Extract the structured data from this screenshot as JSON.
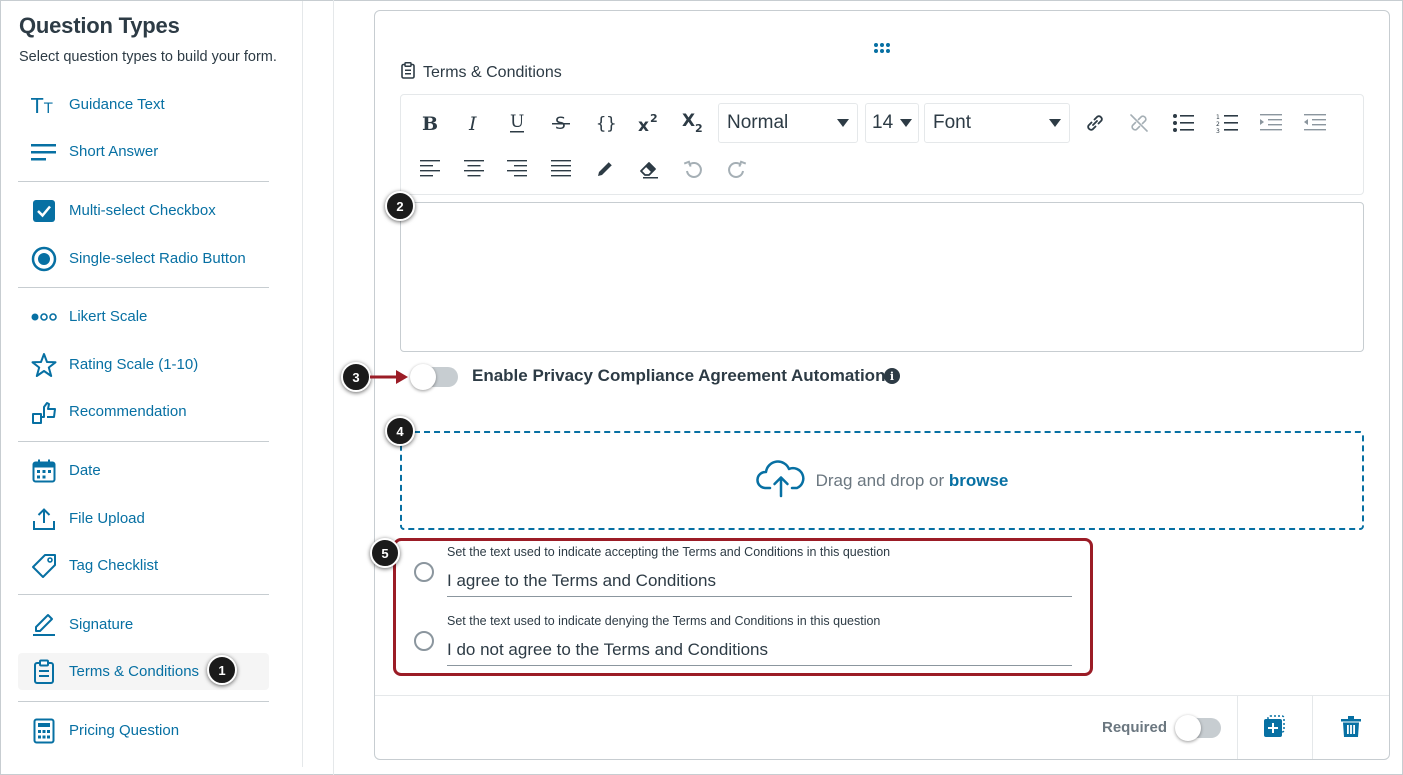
{
  "sidebar": {
    "title": "Question Types",
    "subtitle": "Select question types to build your form.",
    "items": [
      {
        "label": "Guidance Text",
        "icon": "text-size-icon"
      },
      {
        "label": "Short Answer",
        "icon": "short-answer-icon"
      },
      {
        "label": "Multi-select Checkbox",
        "icon": "checkbox-icon"
      },
      {
        "label": "Single-select Radio Button",
        "icon": "radio-button-icon"
      },
      {
        "label": "Likert Scale",
        "icon": "likert-icon"
      },
      {
        "label": "Rating Scale (1-10)",
        "icon": "star-icon"
      },
      {
        "label": "Recommendation",
        "icon": "recommendation-icon"
      },
      {
        "label": "Date",
        "icon": "calendar-icon"
      },
      {
        "label": "File Upload",
        "icon": "upload-icon"
      },
      {
        "label": "Tag Checklist",
        "icon": "tag-icon"
      },
      {
        "label": "Signature",
        "icon": "pencil-icon"
      },
      {
        "label": "Terms & Conditions",
        "icon": "clipboard-icon"
      },
      {
        "label": "Pricing Question",
        "icon": "calculator-icon"
      }
    ],
    "active_item": "Terms & Conditions"
  },
  "question": {
    "title": "Terms & Conditions",
    "toolbar": {
      "paragraph_format": "Normal",
      "font_size": "14",
      "font_family": "Font"
    },
    "privacy_toggle_label": "Enable Privacy Compliance Agreement Automation",
    "privacy_toggle_on": false,
    "dropzone": {
      "text": "Drag and drop or",
      "link": "browse"
    },
    "options": [
      {
        "hint": "Set the text used to indicate accepting the Terms and Conditions in this question",
        "value": "I agree to the Terms and Conditions"
      },
      {
        "hint": "Set the text used to indicate denying the Terms and Conditions in this question",
        "value": "I do not agree to the Terms and Conditions"
      }
    ]
  },
  "footer": {
    "required_label": "Required",
    "required_on": false
  },
  "callouts": [
    "1",
    "2",
    "3",
    "4",
    "5"
  ],
  "colors": {
    "link": "#0770a3",
    "text": "#2d3b45",
    "highlight": "#9b1c26",
    "border": "#c7cdd1"
  }
}
